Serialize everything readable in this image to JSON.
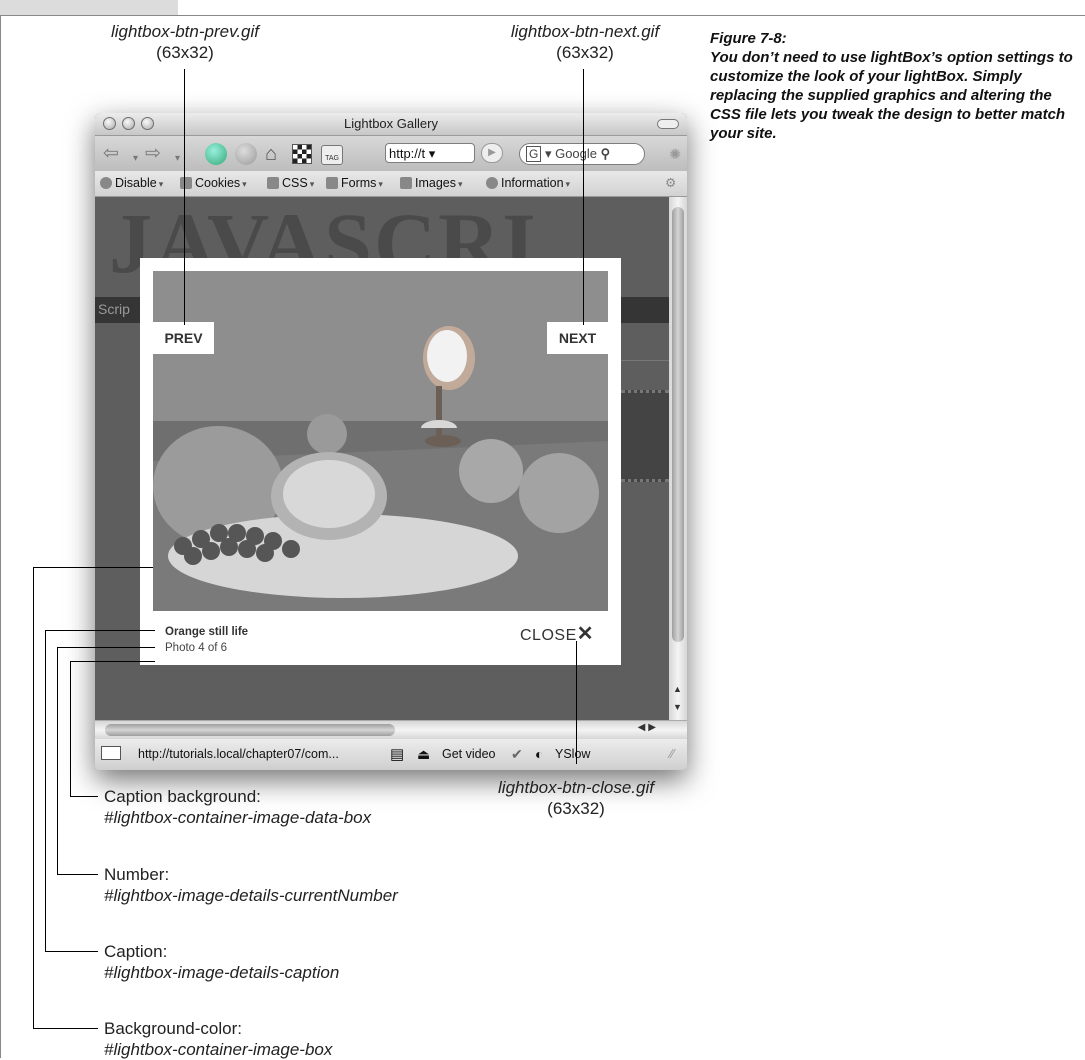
{
  "figure": {
    "title": "Figure 7-8:",
    "text": "You don’t need to use lightBox’s option settings to customize the look of your lightBox. Simply replacing the supplied graphics and altering the CSS file lets you tweak the design to better match your site."
  },
  "callouts": {
    "prev": {
      "file": "lightbox-btn-prev.gif",
      "size": "(63x32)"
    },
    "next": {
      "file": "lightbox-btn-next.gif",
      "size": "(63x32)"
    },
    "close": {
      "file": "lightbox-btn-close.gif",
      "size": "(63x32)"
    },
    "caption_bg": {
      "label": "Caption background:",
      "selector": "#lightbox-container-image-data-box"
    },
    "number": {
      "label": "Number:",
      "selector": "#lightbox-image-details-currentNumber"
    },
    "caption": {
      "label": "Caption:",
      "selector": "#lightbox-image-details-caption"
    },
    "bg_color": {
      "label": "Background-color:",
      "selector": "#lightbox-container-image-box"
    }
  },
  "browser": {
    "title": "Lightbox Gallery",
    "url": "http://t",
    "search_placeholder": "Google",
    "devbar": [
      "Disable",
      "Cookies",
      "CSS",
      "Forms",
      "Images",
      "Information"
    ],
    "page_bg_word": "JAVASCRI",
    "page_bg_band": "Scrip",
    "status_url": "http://tutorials.local/chapter07/com...",
    "status_video": "Get video",
    "status_yslow": "YSlow"
  },
  "lightbox": {
    "prev_label": "PREV",
    "next_label": "NEXT",
    "caption": "Orange still life",
    "number": "Photo 4 of 6",
    "close_label": "CLOSE",
    "close_glyph": "✕"
  },
  "colors": {
    "overlay": "#5e5e5e",
    "lightbox_bg": "#ffffff",
    "photo_tone": "#8c8c8c"
  }
}
